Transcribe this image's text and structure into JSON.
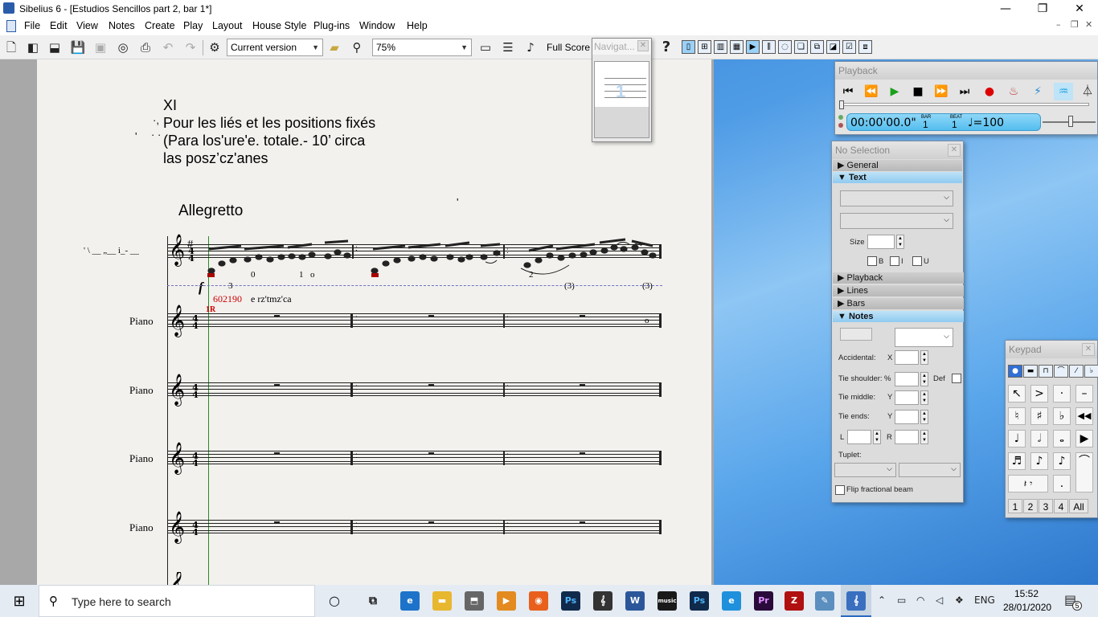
{
  "window": {
    "title": "Sibelius 6 - [Estudios Sencillos part 2, bar 1*]",
    "controls": {
      "minimize": "—",
      "restore": "❐",
      "close": "✕"
    },
    "mdi_controls": {
      "minimize": "–",
      "restore": "❐",
      "close": "✕"
    }
  },
  "menu": [
    "File",
    "Edit",
    "View",
    "Notes",
    "Create",
    "Play",
    "Layout",
    "House Style",
    "Plug-ins",
    "Window",
    "Help"
  ],
  "toolbar": {
    "version_select": "Current version",
    "zoom": "75%",
    "score_view": "Full Score",
    "help": "?"
  },
  "navigator": {
    "title": "Navigat...",
    "page_number": "1"
  },
  "score": {
    "heading_lines": [
      "XI",
      "Pour les liés et les positions fixés",
      "(Para los'ure'e. totale.- 10’ circa",
      "las posz’cz'anes"
    ],
    "left_marks": [
      "·,",
      "· ·",
      "'"
    ],
    "tempo": "Allegretto",
    "guitar_staff_label": "' \\ __ „__ i_- __",
    "dynamic": "f",
    "fingerings": [
      "3",
      "0",
      "1",
      "o",
      "2"
    ],
    "triplets": [
      "(3)",
      "(3)"
    ],
    "red_text": "602190",
    "black_text": "e rz'tmz'ca",
    "marker_red": "1R",
    "stray_tick": "'",
    "whole_note": "o",
    "staff_labels": [
      "Piano",
      "Piano",
      "Piano",
      "Piano"
    ],
    "time_signature": {
      "top": "4",
      "bottom": "4"
    },
    "key_signature": "#"
  },
  "playback": {
    "title": "Playback",
    "time": "00:00'00.0\"",
    "bar_label": "BAR",
    "bar": "1",
    "beat_label": "BEAT",
    "beat": "1",
    "tempo": "♩=100"
  },
  "properties": {
    "title": "No Selection",
    "sections": {
      "general": "General",
      "text": "Text",
      "playback": "Playback",
      "lines": "Lines",
      "bars": "Bars",
      "notes": "Notes"
    },
    "text_size_label": "Size",
    "bold": "B",
    "italic": "I",
    "underline": "U",
    "notes": {
      "accidental": "Accidental:",
      "x": "X",
      "tie_shoulder": "Tie shoulder:",
      "percent": "%",
      "def": "Def",
      "tie_middle": "Tie middle:",
      "y1": "Y",
      "tie_ends": "Tie ends:",
      "y2": "Y",
      "l": "L",
      "r": "R",
      "tuplet": "Tuplet:",
      "flip": "Flip fractional beam"
    }
  },
  "keypad": {
    "title": "Keypad",
    "rows": [
      [
        "↖",
        ">",
        "·",
        "–"
      ],
      [
        "♮",
        "♯",
        "♭",
        "◀◀"
      ],
      [
        "♩",
        "𝅗𝅥",
        "𝅝",
        "▶"
      ],
      [
        "♬",
        "♪",
        "♪",
        "⌒"
      ],
      [
        "𝄽 𝄾",
        "",
        ".",
        ""
      ]
    ],
    "layouts": [
      "1",
      "2",
      "3",
      "4",
      "All"
    ]
  },
  "taskbar": {
    "search_placeholder": "Type here to search",
    "lang": "ENG",
    "time": "15:52",
    "date": "28/01/2020",
    "notifications": "5"
  }
}
